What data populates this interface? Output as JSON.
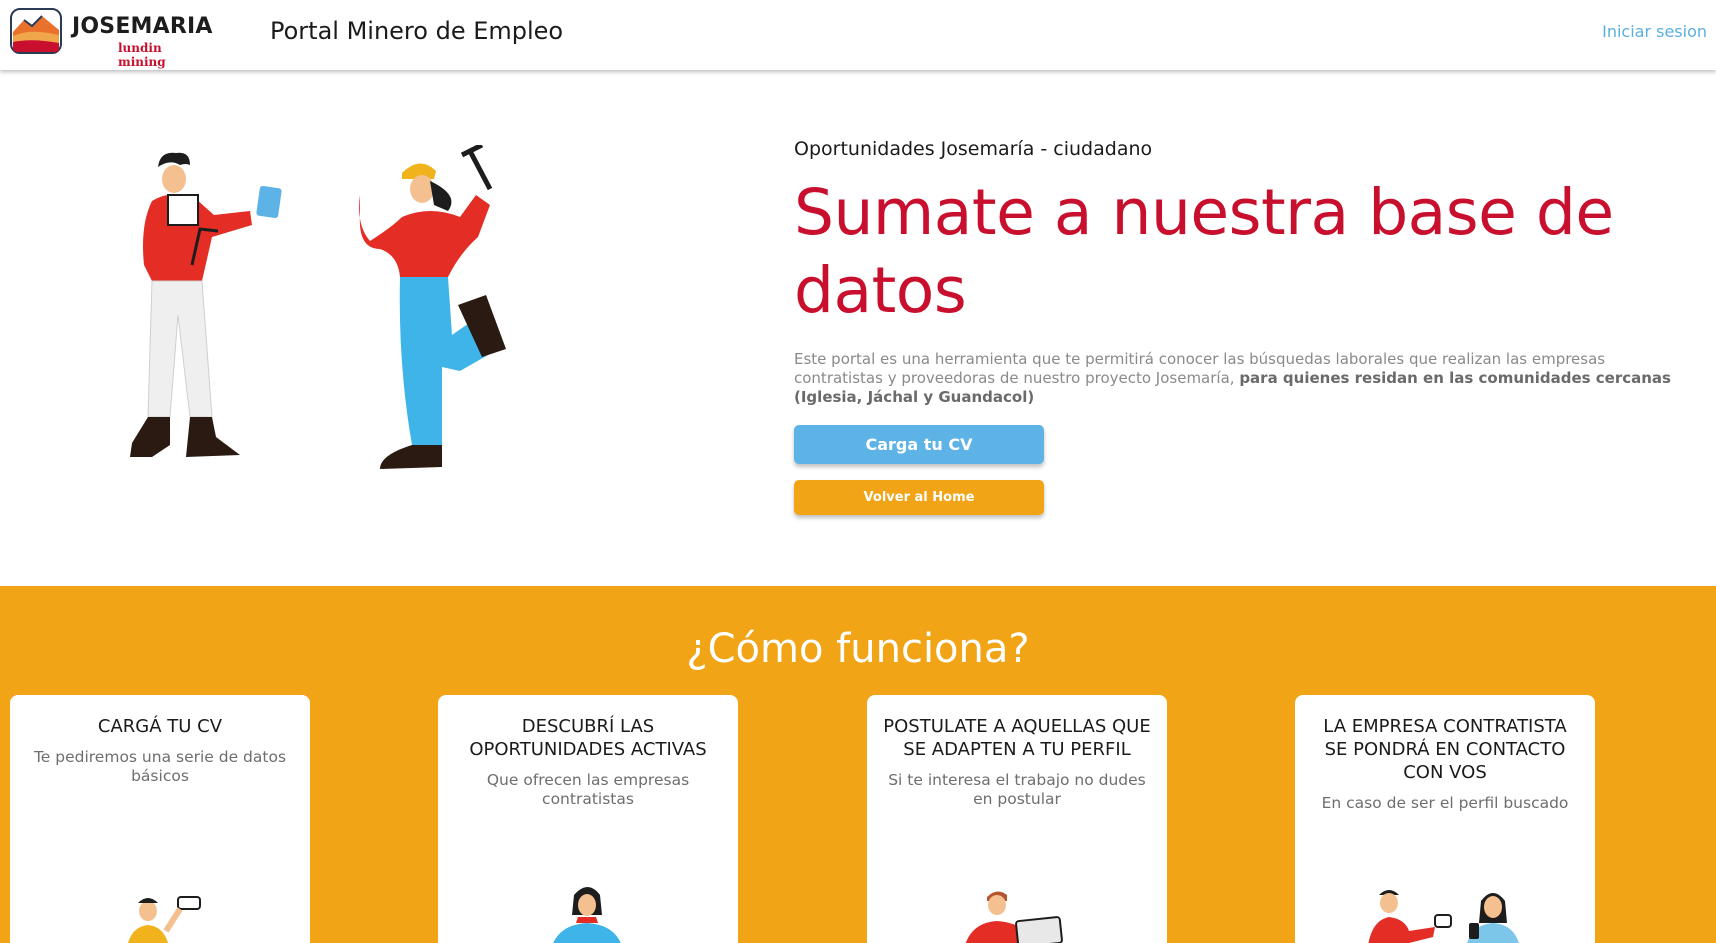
{
  "header": {
    "logo_name": "JOSEMARIA",
    "logo_sub": "lundin mining",
    "portal_title": "Portal Minero de Empleo",
    "login_label": "Iniciar sesion"
  },
  "hero": {
    "subtitle": "Oportunidades Josemaría - ciudadano",
    "title": "Sumate a nuestra base de datos",
    "description_plain": "Este portal es una herramienta que te permitirá conocer las búsquedas laborales que realizan las empresas contratistas y proveedoras de nuestro proyecto Josemaría, ",
    "description_bold": "para quienes residan en las comunidades cercanas (Iglesia, Jáchal y Guandacol)",
    "cv_button": "Carga tu CV",
    "home_button": "Volver al Home"
  },
  "how": {
    "title": "¿Cómo funciona?",
    "cards": [
      {
        "title": "CARGÁ TU CV",
        "desc": "Te pediremos una serie de datos básicos"
      },
      {
        "title": "DESCUBRÍ LAS OPORTUNIDADES ACTIVAS",
        "desc": "Que ofrecen las empresas contratistas"
      },
      {
        "title": "POSTULATE A AQUELLAS QUE SE ADAPTEN A TU PERFIL",
        "desc": "Si te interesa el trabajo no dudes en postular"
      },
      {
        "title": "LA EMPRESA CONTRATISTA SE PONDRÁ EN CONTACTO CON VOS",
        "desc": "En caso de ser el perfil buscado"
      }
    ]
  },
  "colors": {
    "brand_red": "#c8102e",
    "accent_orange": "#f0a416",
    "accent_blue": "#5db3e6",
    "link_blue": "#5aafe0"
  }
}
